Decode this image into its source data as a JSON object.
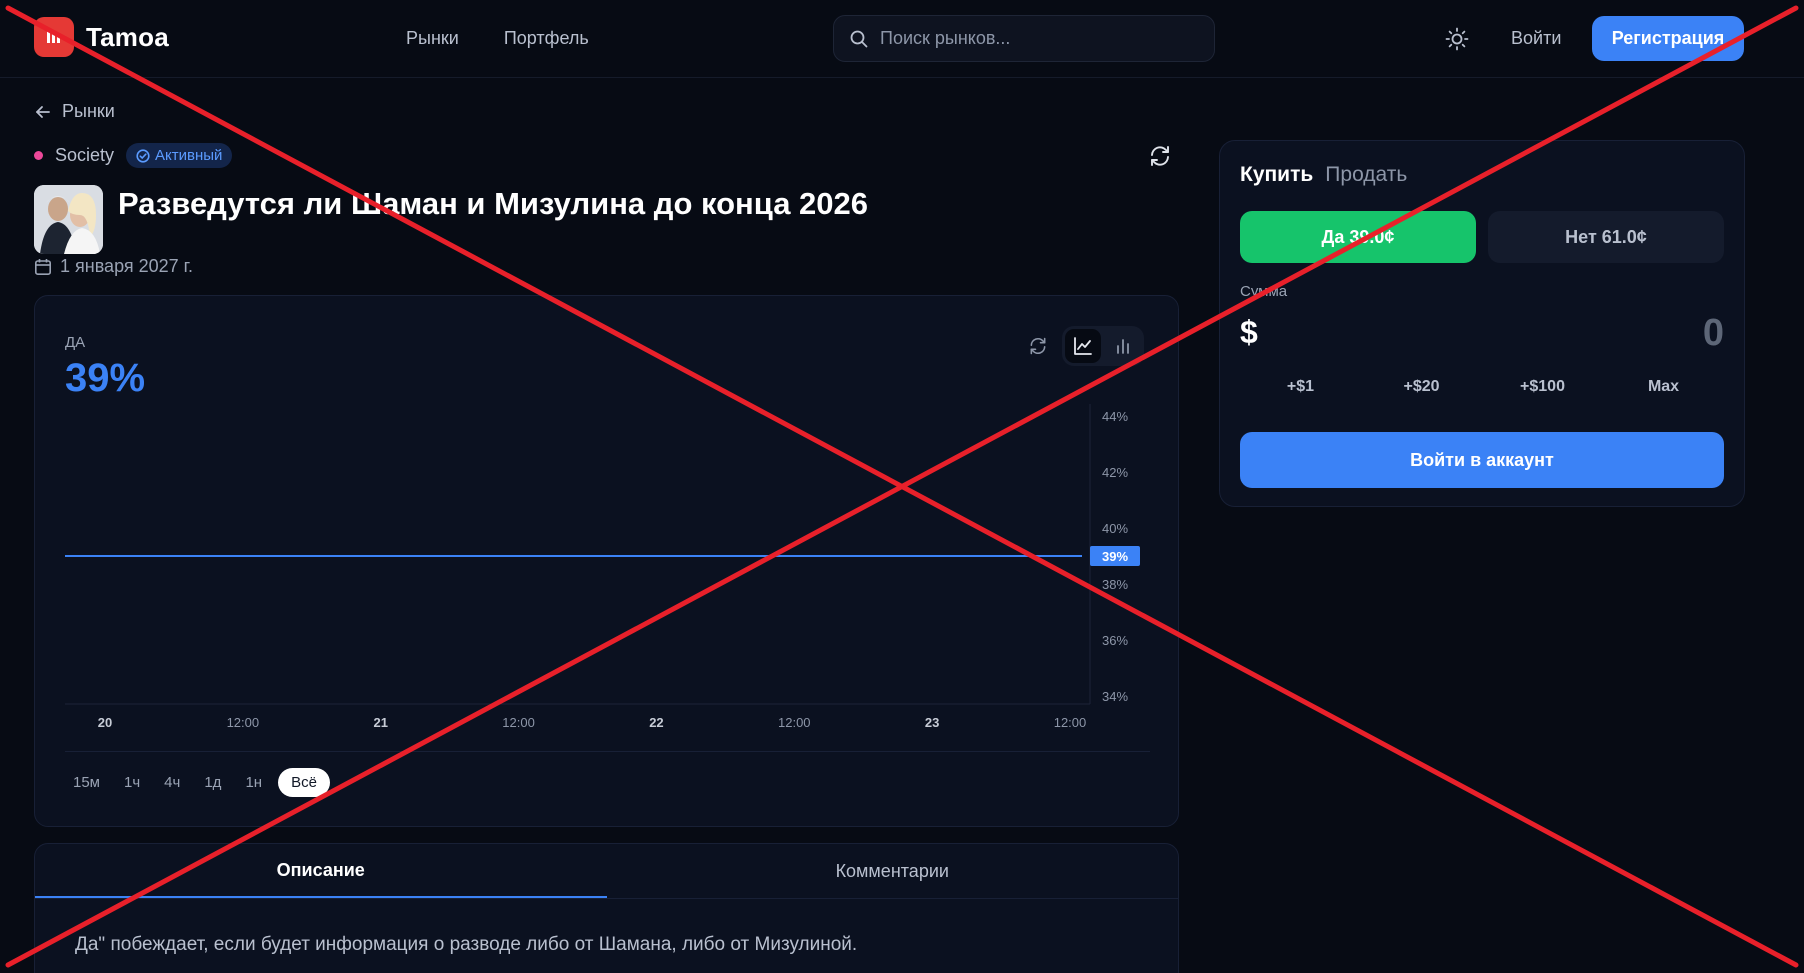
{
  "header": {
    "brand": "Tamoa",
    "nav": [
      "Рынки",
      "Портфель"
    ],
    "search_placeholder": "Поиск рынков...",
    "login": "Войти",
    "register": "Регистрация"
  },
  "market": {
    "back": "Рынки",
    "category": "Society",
    "status": "Активный",
    "title": "Разведутся ли Шаман и Мизулина до конца 2026",
    "date": "1 января 2027 г."
  },
  "chart": {
    "outcome_label": "ДА",
    "outcome_value": "39%",
    "ranges": [
      "15м",
      "1ч",
      "4ч",
      "1д",
      "1н",
      "Всё"
    ],
    "active_range": "Всё"
  },
  "chart_data": {
    "type": "line",
    "x_ticks": [
      "20",
      "12:00",
      "21",
      "12:00",
      "22",
      "12:00",
      "23",
      "12:00"
    ],
    "y_ticks": [
      "44%",
      "42%",
      "40%",
      "38%",
      "36%",
      "34%"
    ],
    "ylim": [
      34,
      44
    ],
    "series": [
      {
        "values": [
          39,
          39
        ]
      }
    ],
    "current_label": "39%",
    "colors": {
      "line": "#3b82f6",
      "label_bg": "#3b82f6"
    }
  },
  "tabs": [
    "Описание",
    "Комментарии"
  ],
  "description": "Да\" побеждает, если будет информация о разводе либо от Шамана, либо от Мизулиной.",
  "trade": {
    "tab_buy": "Купить",
    "tab_sell": "Продать",
    "yes": "Да 39.0¢",
    "no": "Нет 61.0¢",
    "amount_label": "Сумма",
    "currency": "$",
    "amount": "0",
    "quick": [
      "+$1",
      "+$20",
      "+$100",
      "Max"
    ],
    "account_button": "Войти в аккаунт"
  },
  "colors": {
    "accent": "#3b82f6",
    "yes": "#16c46b",
    "brand": "#e53935",
    "overlay": "#e8202a"
  }
}
